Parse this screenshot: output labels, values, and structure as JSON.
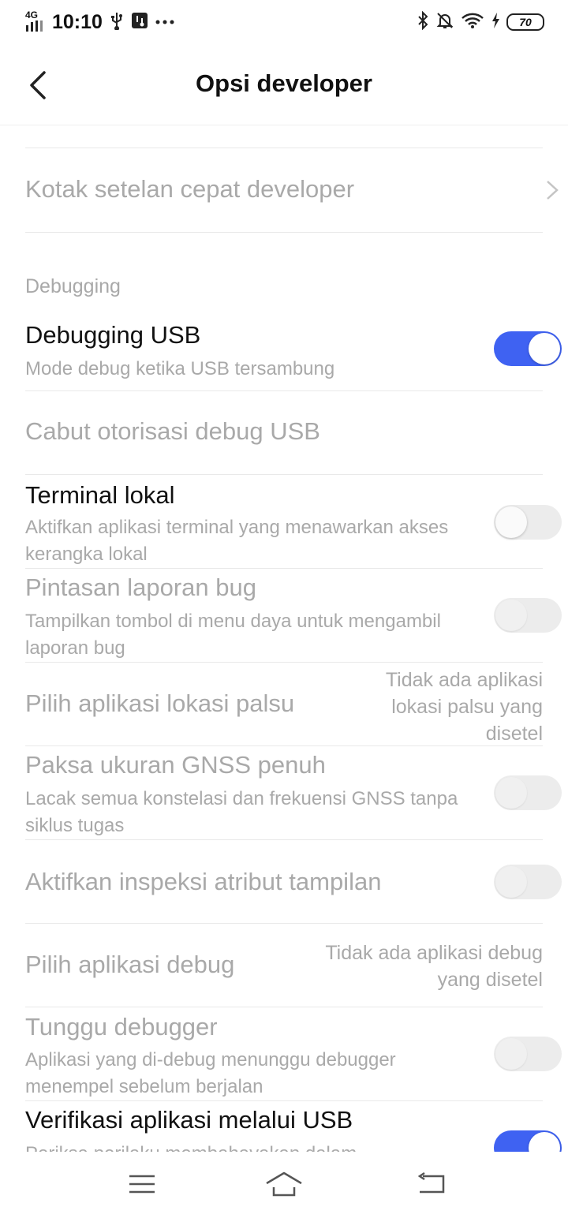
{
  "status_bar": {
    "network": "4G",
    "time": "10:10",
    "battery": "70",
    "icons": [
      "signal-icon",
      "usb-icon",
      "usb-debug-icon",
      "more-dots-icon",
      "bluetooth-icon",
      "silent-bell-icon",
      "wifi-icon",
      "charging-icon",
      "battery-icon"
    ]
  },
  "header": {
    "title": "Opsi developer"
  },
  "items": {
    "quick_tiles": {
      "label": "Kotak setelan cepat developer"
    },
    "section_debugging": "Debugging",
    "usb_debugging": {
      "label": "Debugging USB",
      "sub": "Mode debug ketika USB tersambung",
      "on": true
    },
    "revoke_usb": {
      "label": "Cabut otorisasi debug USB"
    },
    "local_terminal": {
      "label": "Terminal lokal",
      "sub": "Aktifkan aplikasi terminal yang menawarkan akses kerangka lokal",
      "on": false
    },
    "bug_report": {
      "label": "Pintasan laporan bug",
      "sub": "Tampilkan tombol di menu daya untuk mengambil laporan bug",
      "on": false
    },
    "mock_location": {
      "label": "Pilih aplikasi lokasi palsu",
      "value": "Tidak ada aplikasi lokasi palsu yang disetel"
    },
    "gnss": {
      "label": "Paksa ukuran GNSS penuh",
      "sub": "Lacak semua konstelasi dan frekuensi GNSS tanpa siklus tugas",
      "on": false
    },
    "view_attr": {
      "label": "Aktifkan inspeksi atribut tampilan",
      "on": false
    },
    "debug_app": {
      "label": "Pilih aplikasi debug",
      "value": "Tidak ada aplikasi debug yang disetel"
    },
    "wait_debugger": {
      "label": "Tunggu debugger",
      "sub": "Aplikasi yang di-debug menunggu debugger menempel sebelum berjalan",
      "on": false
    },
    "verify_usb": {
      "label": "Verifikasi aplikasi melalui USB",
      "sub": "Periksa perilaku membahayakan dalam",
      "on": true
    }
  },
  "navbar": {
    "icons": [
      "menu-icon",
      "home-icon",
      "back-nav-icon"
    ]
  }
}
